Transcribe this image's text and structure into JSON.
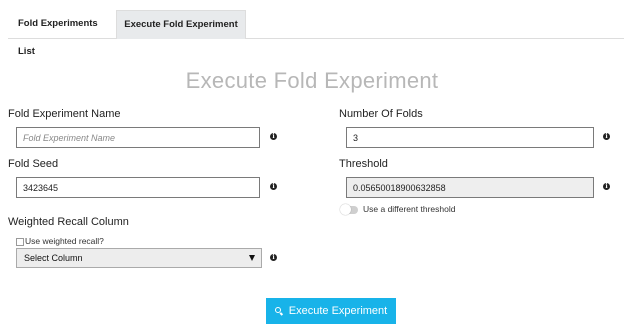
{
  "tabs": [
    {
      "label": "Fold Experiments List"
    },
    {
      "label": "Execute Fold Experiment"
    }
  ],
  "page_title": "Execute Fold Experiment",
  "form": {
    "fold_experiment_name": {
      "label": "Fold Experiment Name",
      "placeholder": "Fold Experiment Name",
      "value": ""
    },
    "fold_seed": {
      "label": "Fold Seed",
      "value": "3423645"
    },
    "weighted_recall_column": {
      "label": "Weighted Recall Column",
      "checkbox_label": "Use weighted recall?",
      "checked": false,
      "select_value": "Select Column"
    },
    "number_of_folds": {
      "label": "Number Of Folds",
      "value": "3"
    },
    "threshold": {
      "label": "Threshold",
      "value": "0.05650018900632858",
      "toggle_label": "Use a different threshold",
      "toggle_on": false
    }
  },
  "info_glyph": "i",
  "execute_button": {
    "label": "Execute Experiment",
    "icon": "search-icon"
  },
  "colors": {
    "accent": "#18b3e9",
    "title": "#b7b7b7",
    "readonly_bg": "#eeeeee",
    "tab_active_bg": "#e8eaec"
  }
}
